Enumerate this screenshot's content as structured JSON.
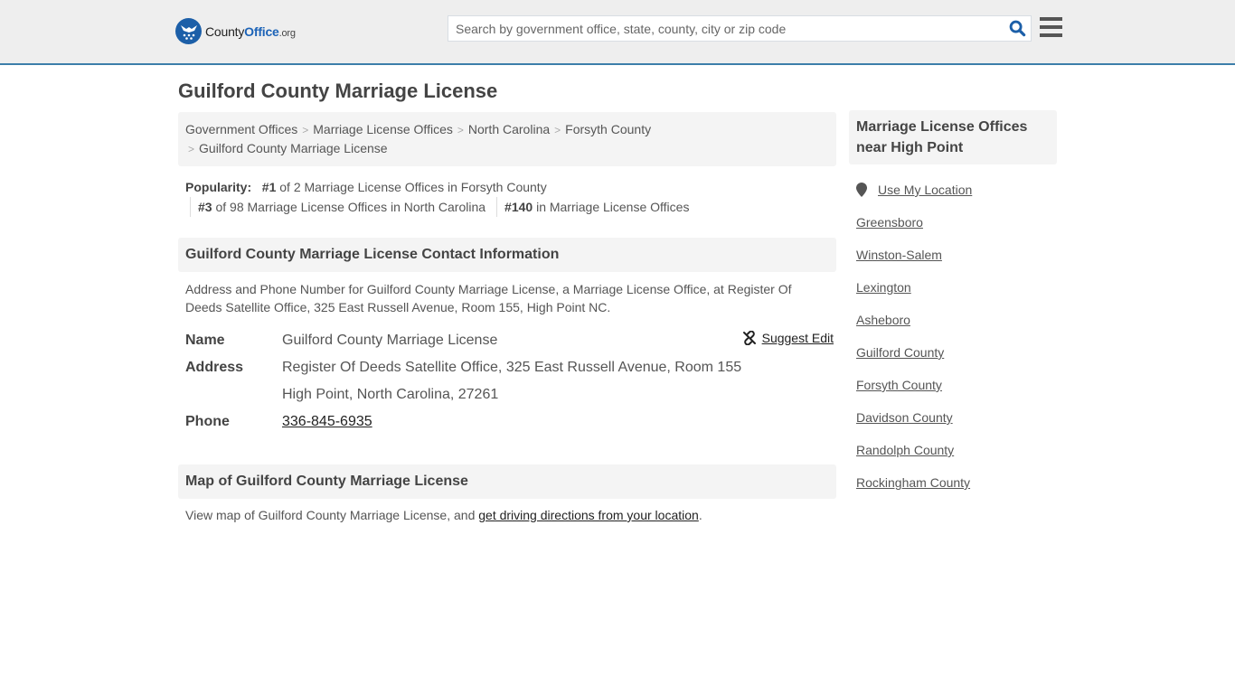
{
  "header": {
    "logo": {
      "name_part1": "County",
      "name_part2": "Office",
      "tld": ".org",
      "badge_icon": "eagle-stars-icon"
    },
    "search": {
      "placeholder": "Search by government office, state, county, city or zip code",
      "value": ""
    },
    "search_icon": "search-icon",
    "menu_icon": "hamburger-menu-icon"
  },
  "page": {
    "title": "Guilford County Marriage License"
  },
  "breadcrumb": [
    {
      "label": "Government Offices"
    },
    {
      "label": "Marriage License Offices"
    },
    {
      "label": "North Carolina"
    },
    {
      "label": "Forsyth County"
    },
    {
      "label": "Guilford County Marriage License"
    }
  ],
  "popularity": {
    "label": "Popularity:",
    "items": [
      {
        "rank": "#1",
        "text": " of 2 Marriage License Offices in Forsyth County"
      },
      {
        "rank": "#3",
        "text": " of 98 Marriage License Offices in North Carolina"
      },
      {
        "rank": "#140",
        "text": " in Marriage License Offices"
      }
    ]
  },
  "contact": {
    "heading": "Guilford County Marriage License Contact Information",
    "description": "Address and Phone Number for Guilford County Marriage License, a Marriage License Office, at Register Of Deeds Satellite Office, 325 East Russell Avenue, Room 155, High Point NC.",
    "suggest_edit": "Suggest Edit",
    "rows": {
      "name": {
        "label": "Name",
        "value": "Guilford County Marriage License"
      },
      "address": {
        "label": "Address",
        "line1": "Register Of Deeds Satellite Office, 325 East Russell Avenue, Room 155",
        "line2": "High Point, North Carolina, 27261"
      },
      "phone": {
        "label": "Phone",
        "value": "336-845-6935"
      }
    }
  },
  "map": {
    "heading": "Map of Guilford County Marriage License",
    "text_before": "View map of Guilford County Marriage License, and ",
    "link": "get driving directions from your location",
    "text_after": "."
  },
  "sidebar": {
    "heading": "Marriage License Offices near High Point",
    "use_location": "Use My Location",
    "links": [
      "Greensboro",
      "Winston-Salem",
      "Lexington",
      "Asheboro",
      "Guilford County",
      "Forsyth County",
      "Davidson County",
      "Randolph County",
      "Rockingham County"
    ]
  },
  "colors": {
    "brand_blue": "#1c63b7",
    "header_border": "#3d7eaa",
    "header_bg": "#eeeeee",
    "panel_bg": "#f4f4f4"
  }
}
